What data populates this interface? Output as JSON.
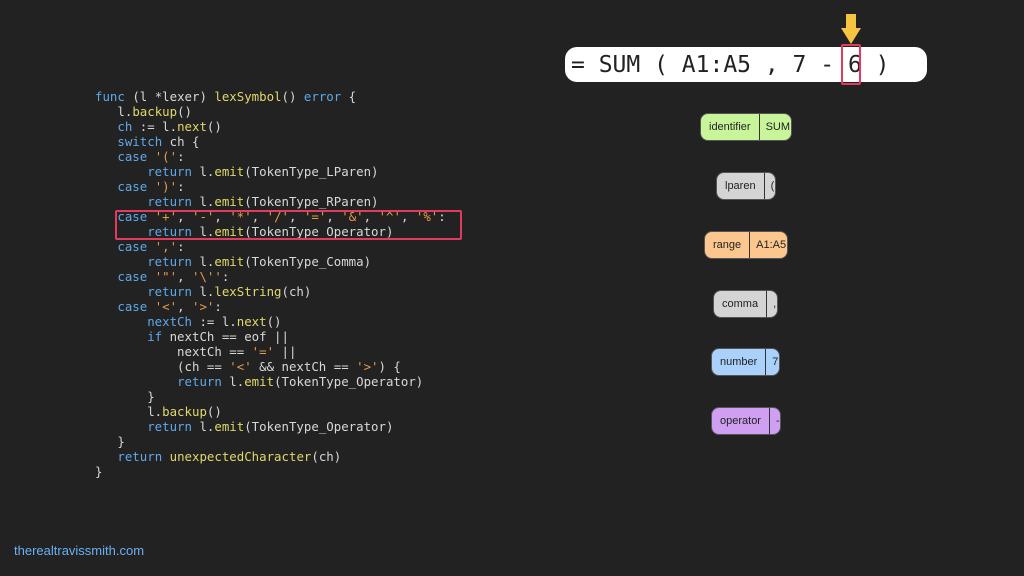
{
  "code": {
    "lines": [
      [
        {
          "t": "func ",
          "c": "kw"
        },
        {
          "t": "(l *lexer) "
        },
        {
          "t": "lexSymbol",
          "c": "fn"
        },
        {
          "t": "() "
        },
        {
          "t": "error",
          "c": "kw"
        },
        {
          "t": " {"
        }
      ],
      [
        {
          "t": "   l."
        },
        {
          "t": "backup",
          "c": "fn"
        },
        {
          "t": "()"
        }
      ],
      [
        {
          "t": "   "
        },
        {
          "t": "ch",
          "c": "kw"
        },
        {
          "t": " := l."
        },
        {
          "t": "next",
          "c": "fn"
        },
        {
          "t": "()"
        }
      ],
      [
        {
          "t": "   "
        },
        {
          "t": "switch",
          "c": "kw"
        },
        {
          "t": " ch {"
        }
      ],
      [
        {
          "t": "   "
        },
        {
          "t": "case",
          "c": "kw"
        },
        {
          "t": " "
        },
        {
          "t": "'('",
          "c": "str"
        },
        {
          "t": ":"
        }
      ],
      [
        {
          "t": "       "
        },
        {
          "t": "return",
          "c": "kw"
        },
        {
          "t": " l."
        },
        {
          "t": "emit",
          "c": "fn"
        },
        {
          "t": "(TokenType_LParen)"
        }
      ],
      [
        {
          "t": "   "
        },
        {
          "t": "case",
          "c": "kw"
        },
        {
          "t": " "
        },
        {
          "t": "')'",
          "c": "str"
        },
        {
          "t": ":"
        }
      ],
      [
        {
          "t": "       "
        },
        {
          "t": "return",
          "c": "kw"
        },
        {
          "t": " l."
        },
        {
          "t": "emit",
          "c": "fn"
        },
        {
          "t": "(TokenType_RParen)"
        }
      ],
      [
        {
          "t": "   "
        },
        {
          "t": "case",
          "c": "kw"
        },
        {
          "t": " "
        },
        {
          "t": "'+'",
          "c": "str"
        },
        {
          "t": ", "
        },
        {
          "t": "'-'",
          "c": "str"
        },
        {
          "t": ", "
        },
        {
          "t": "'*'",
          "c": "str"
        },
        {
          "t": ", "
        },
        {
          "t": "'/'",
          "c": "str"
        },
        {
          "t": ", "
        },
        {
          "t": "'='",
          "c": "str"
        },
        {
          "t": ", "
        },
        {
          "t": "'&'",
          "c": "str"
        },
        {
          "t": ", "
        },
        {
          "t": "'^'",
          "c": "str"
        },
        {
          "t": ", "
        },
        {
          "t": "'%'",
          "c": "str"
        },
        {
          "t": ":"
        }
      ],
      [
        {
          "t": "       "
        },
        {
          "t": "return",
          "c": "kw"
        },
        {
          "t": " l."
        },
        {
          "t": "emit",
          "c": "fn"
        },
        {
          "t": "(TokenType_Operator)"
        }
      ],
      [
        {
          "t": "   "
        },
        {
          "t": "case",
          "c": "kw"
        },
        {
          "t": " "
        },
        {
          "t": "','",
          "c": "str"
        },
        {
          "t": ":"
        }
      ],
      [
        {
          "t": "       "
        },
        {
          "t": "return",
          "c": "kw"
        },
        {
          "t": " l."
        },
        {
          "t": "emit",
          "c": "fn"
        },
        {
          "t": "(TokenType_Comma)"
        }
      ],
      [
        {
          "t": "   "
        },
        {
          "t": "case",
          "c": "kw"
        },
        {
          "t": " "
        },
        {
          "t": "'\"'",
          "c": "str"
        },
        {
          "t": ", "
        },
        {
          "t": "'\\''",
          "c": "str"
        },
        {
          "t": ":"
        }
      ],
      [
        {
          "t": "       "
        },
        {
          "t": "return",
          "c": "kw"
        },
        {
          "t": " l."
        },
        {
          "t": "lexString",
          "c": "fn"
        },
        {
          "t": "(ch)"
        }
      ],
      [
        {
          "t": "   "
        },
        {
          "t": "case",
          "c": "kw"
        },
        {
          "t": " "
        },
        {
          "t": "'<'",
          "c": "str"
        },
        {
          "t": ", "
        },
        {
          "t": "'>'",
          "c": "str"
        },
        {
          "t": ":"
        }
      ],
      [
        {
          "t": "       "
        },
        {
          "t": "nextCh",
          "c": "kw"
        },
        {
          "t": " := l."
        },
        {
          "t": "next",
          "c": "fn"
        },
        {
          "t": "()"
        }
      ],
      [
        {
          "t": "       "
        },
        {
          "t": "if",
          "c": "kw"
        },
        {
          "t": " nextCh == eof ||"
        }
      ],
      [
        {
          "t": "           nextCh == "
        },
        {
          "t": "'='",
          "c": "str"
        },
        {
          "t": " ||"
        }
      ],
      [
        {
          "t": "           (ch == "
        },
        {
          "t": "'<'",
          "c": "str"
        },
        {
          "t": " && nextCh == "
        },
        {
          "t": "'>'",
          "c": "str"
        },
        {
          "t": ") {"
        }
      ],
      [
        {
          "t": "           "
        },
        {
          "t": "return",
          "c": "kw"
        },
        {
          "t": " l."
        },
        {
          "t": "emit",
          "c": "fn"
        },
        {
          "t": "(TokenType_Operator)"
        }
      ],
      [
        {
          "t": "       }"
        }
      ],
      [
        {
          "t": "       l."
        },
        {
          "t": "backup",
          "c": "fn"
        },
        {
          "t": "()"
        }
      ],
      [
        {
          "t": "       "
        },
        {
          "t": "return",
          "c": "kw"
        },
        {
          "t": " l."
        },
        {
          "t": "emit",
          "c": "fn"
        },
        {
          "t": "(TokenType_Operator)"
        }
      ],
      [
        {
          "t": "   }"
        }
      ],
      [
        {
          "t": "   "
        },
        {
          "t": "return",
          "c": "kw"
        },
        {
          "t": " "
        },
        {
          "t": "unexpectedCharacter",
          "c": "fn"
        },
        {
          "t": "(ch)"
        }
      ],
      [
        {
          "t": "}"
        }
      ]
    ]
  },
  "formula": {
    "text": "= SUM ( A1:A5 , 7 - 6 )"
  },
  "tokens": [
    {
      "type": "identifier",
      "value": "SUM",
      "color": "#c8f59a"
    },
    {
      "type": "lparen",
      "value": "(",
      "color": "#d4d4d4"
    },
    {
      "type": "range",
      "value": "A1:A5",
      "color": "#fbc78e"
    },
    {
      "type": "comma",
      "value": ",",
      "color": "#d4d4d4"
    },
    {
      "type": "number",
      "value": "7",
      "color": "#a9d1fb"
    },
    {
      "type": "operator",
      "value": "-",
      "color": "#cfa0f2"
    }
  ],
  "colors": {
    "highlight": "#e33a5e",
    "arrow": "#f5c542",
    "credit": "#6ab0f5"
  },
  "credit": "therealtravissmith.com"
}
